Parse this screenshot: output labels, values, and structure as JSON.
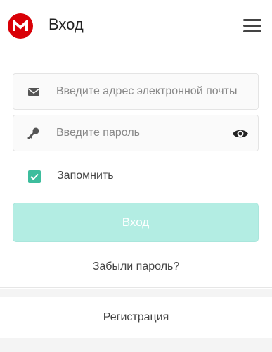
{
  "header": {
    "title": "Вход",
    "logo_letter": "M",
    "brand_color": "#d90007"
  },
  "form": {
    "email_placeholder": "Введите адрес электронной почты",
    "password_placeholder": "Введите пароль",
    "remember_label": "Запомнить",
    "remember_checked": true,
    "login_label": "Вход",
    "forgot_label": "Забыли пароль?",
    "accent_color": "#3dbd9d",
    "button_color": "#b3ede3"
  },
  "footer": {
    "register_label": "Регистрация"
  },
  "icons": {
    "email": "envelope-icon",
    "password": "key-icon",
    "show_password": "eye-icon",
    "menu": "hamburger-menu-icon",
    "check": "check-icon"
  }
}
